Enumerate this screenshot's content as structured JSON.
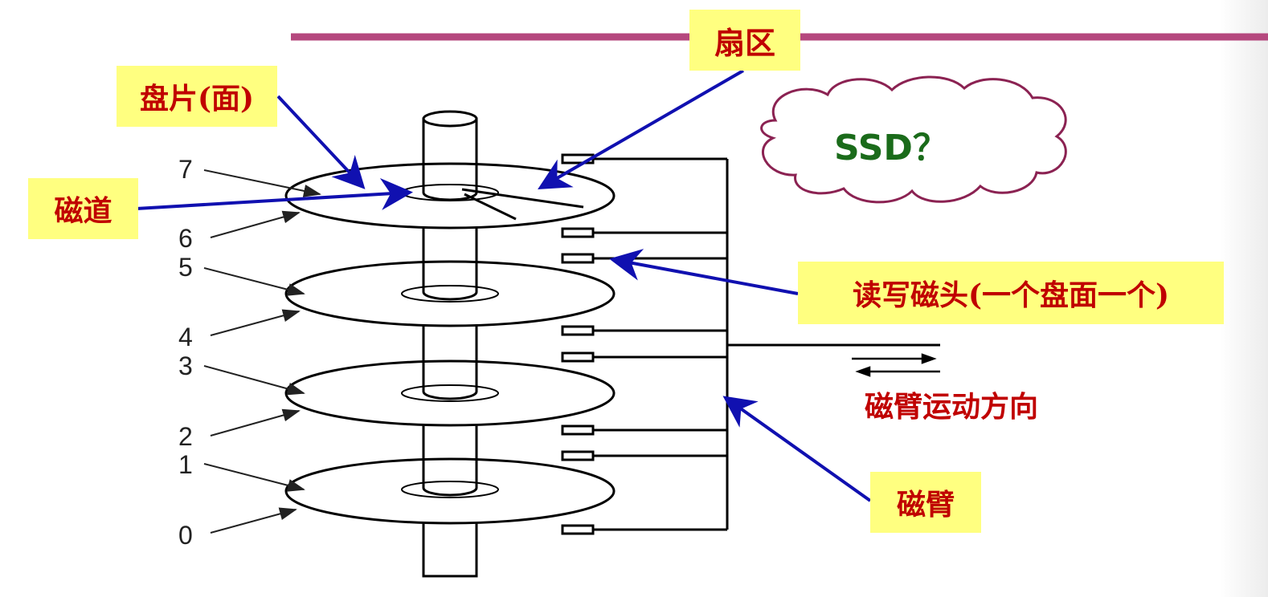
{
  "labels": {
    "sector": "扇区",
    "platter": "盘片(面)",
    "track": "磁道",
    "rw_head": "读写磁头(一个盘面一个)",
    "arm": "磁臂",
    "arm_direction": "磁臂运动方向",
    "ssd": "SSD？"
  },
  "surface_numbers": [
    "0",
    "1",
    "2",
    "3",
    "4",
    "5",
    "6",
    "7"
  ],
  "colors": {
    "top_rule": "#b5487e",
    "label_bg": "#ffff80",
    "label_text": "#c00000",
    "pointer_arrow": "#1010b0",
    "ssd_text": "#1a6b1a",
    "cloud_stroke": "#8b2252"
  }
}
